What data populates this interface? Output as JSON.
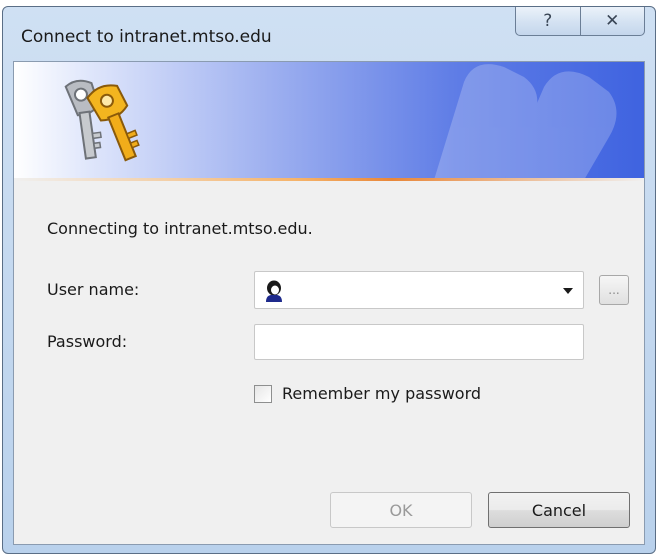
{
  "window": {
    "title": "Connect to intranet.mtso.edu",
    "help_glyph": "?",
    "close_glyph": "✕"
  },
  "dialog": {
    "message": "Connecting to intranet.mtso.edu.",
    "username_label": "User name:",
    "password_label": "Password:",
    "username_value": "",
    "password_value": "",
    "browse_label": "...",
    "remember_label": "Remember my password",
    "remember_checked": false,
    "ok_label": "OK",
    "cancel_label": "Cancel"
  },
  "icons": {
    "banner": "keys-icon",
    "user": "user-icon",
    "dropdown": "chevron-down-icon"
  },
  "colors": {
    "banner_accent": "#3f63e0",
    "stripe_accent": "#e8873a"
  }
}
